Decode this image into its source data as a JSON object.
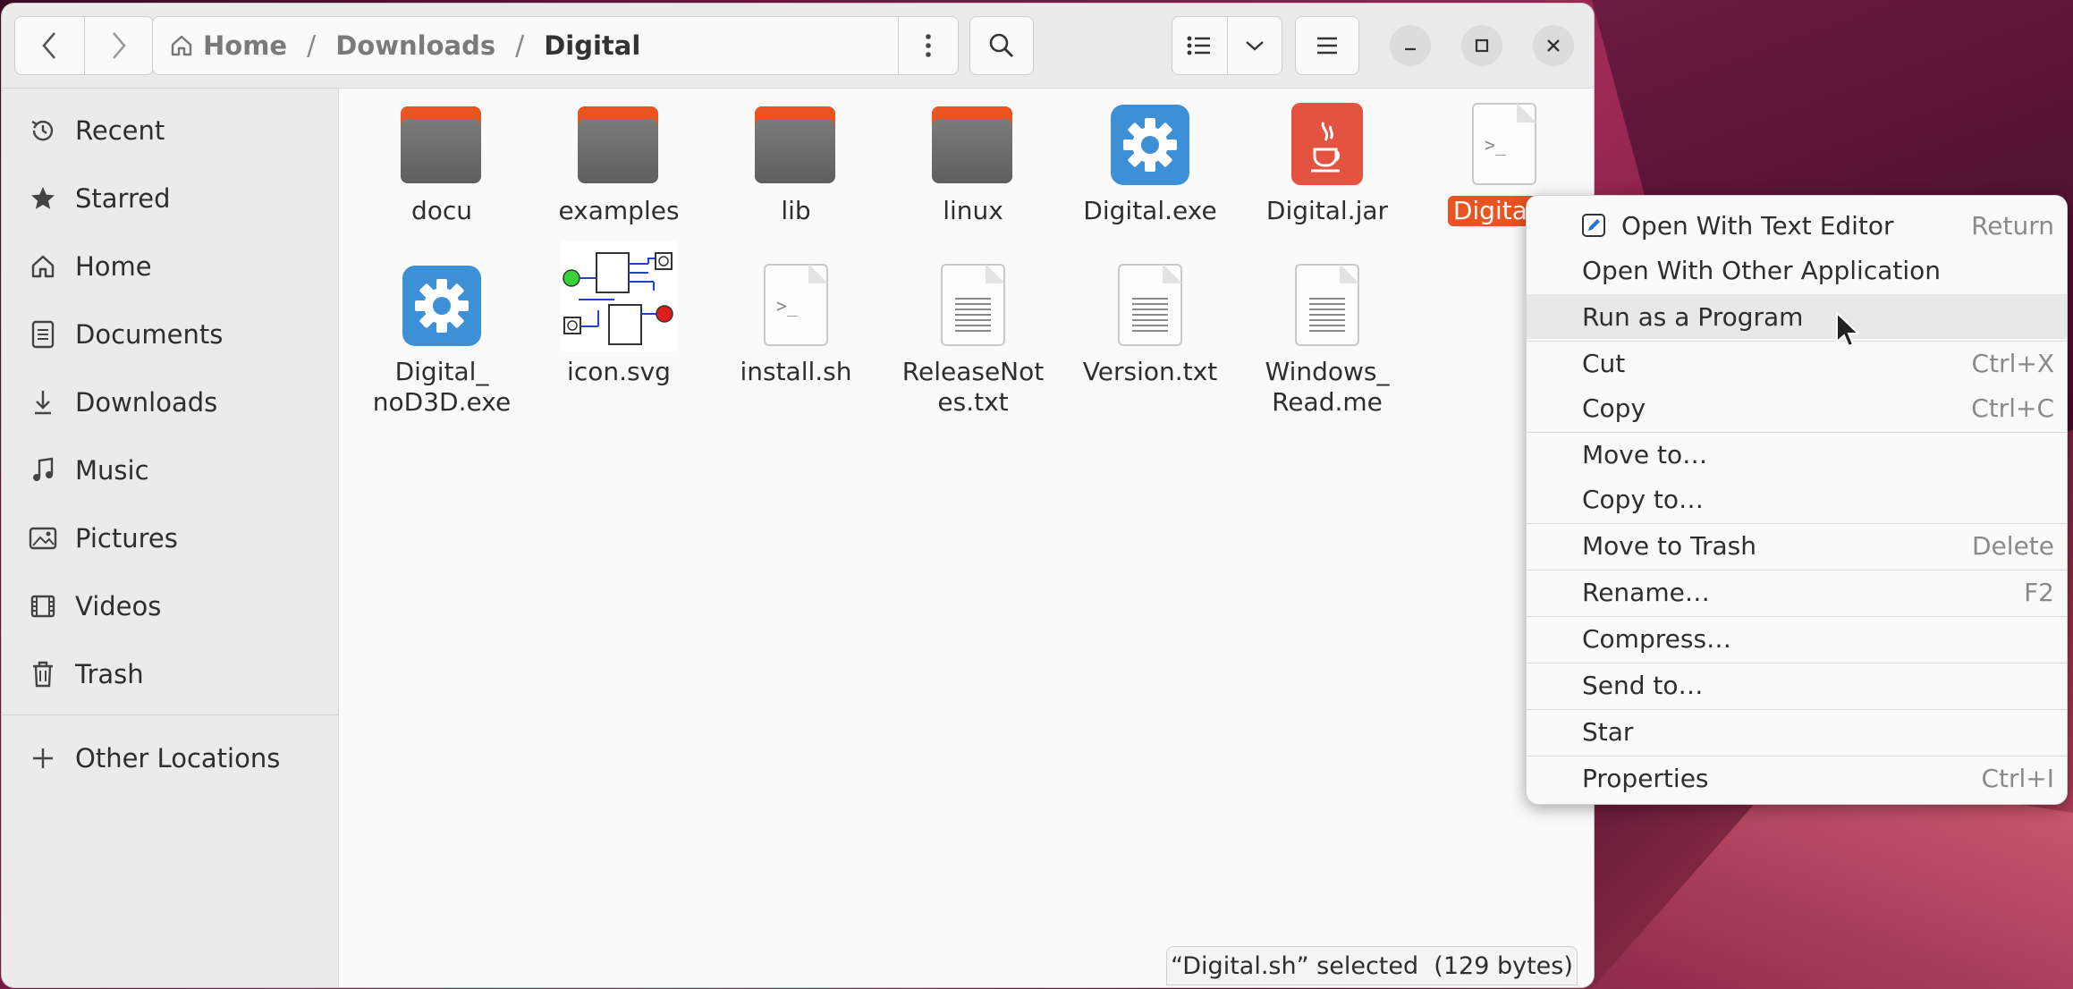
{
  "path": {
    "home": "Home",
    "downloads": "Downloads",
    "current": "Digital"
  },
  "sidebar": {
    "items": [
      {
        "label": "Recent",
        "icon": "clock-icon"
      },
      {
        "label": "Starred",
        "icon": "star-icon"
      },
      {
        "label": "Home",
        "icon": "home-icon"
      },
      {
        "label": "Documents",
        "icon": "document-icon"
      },
      {
        "label": "Downloads",
        "icon": "download-icon"
      },
      {
        "label": "Music",
        "icon": "music-icon"
      },
      {
        "label": "Pictures",
        "icon": "picture-icon"
      },
      {
        "label": "Videos",
        "icon": "video-icon"
      },
      {
        "label": "Trash",
        "icon": "trash-icon"
      }
    ],
    "other": {
      "label": "Other Locations",
      "icon": "plus-icon"
    }
  },
  "files": [
    {
      "name": "docu",
      "type": "folder"
    },
    {
      "name": "examples",
      "type": "folder"
    },
    {
      "name": "lib",
      "type": "folder"
    },
    {
      "name": "linux",
      "type": "folder"
    },
    {
      "name": "Digital.exe",
      "type": "exe"
    },
    {
      "name": "Digital.jar",
      "type": "jar"
    },
    {
      "name": "Digital.sh",
      "type": "script",
      "selected": true,
      "visible_label": "Digital.s"
    },
    {
      "name": "Digital_\nnoD3D.exe",
      "type": "exe"
    },
    {
      "name": "icon.svg",
      "type": "svg"
    },
    {
      "name": "install.sh",
      "type": "script"
    },
    {
      "name": "ReleaseNot\nes.txt",
      "type": "text"
    },
    {
      "name": "Version.txt",
      "type": "text"
    },
    {
      "name": "Windows_\nRead.me",
      "type": "text"
    }
  ],
  "status": "“Digital.sh” selected  (129 bytes)",
  "context_menu": {
    "items": [
      {
        "label": "Open With Text Editor",
        "accel": "Return",
        "icon": "text-editor-icon"
      },
      {
        "label": "Open With Other Application",
        "accel": ""
      },
      {
        "label": "Run as a Program",
        "accel": "",
        "highlighted": true
      },
      {
        "label": "Cut",
        "accel": "Ctrl+X"
      },
      {
        "label": "Copy",
        "accel": "Ctrl+C"
      },
      {
        "label": "Move to…",
        "accel": ""
      },
      {
        "label": "Copy to…",
        "accel": ""
      },
      {
        "label": "Move to Trash",
        "accel": "Delete"
      },
      {
        "label": "Rename…",
        "accel": "F2"
      },
      {
        "label": "Compress…",
        "accel": ""
      },
      {
        "label": "Send to…",
        "accel": ""
      },
      {
        "label": "Star",
        "accel": ""
      },
      {
        "label": "Properties",
        "accel": "Ctrl+I"
      }
    ]
  },
  "colors": {
    "accent": "#e95420",
    "exe_blue": "#3d8fd6",
    "jar_red": "#e4533f"
  }
}
